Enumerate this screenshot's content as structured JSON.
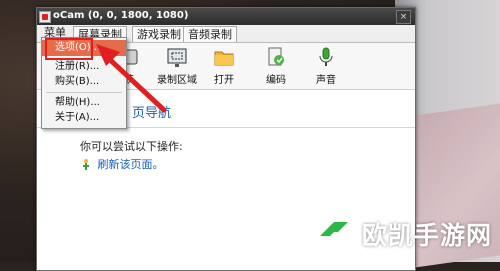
{
  "window": {
    "title": "oCam (0, 0, 1800, 1080)",
    "close": "×"
  },
  "menubar": {
    "menu": "菜单"
  },
  "tabs": [
    "屏幕录制",
    "游戏录制",
    "音频录制"
  ],
  "toolbar": {
    "items": [
      {
        "label": "获",
        "icon": "capture-icon"
      },
      {
        "label": "录制区域",
        "icon": "record-area-icon"
      },
      {
        "label": "打开",
        "icon": "folder-icon"
      },
      {
        "label": "编码",
        "icon": "codec-icon"
      },
      {
        "label": "声音",
        "icon": "sound-icon"
      }
    ]
  },
  "dropdown": {
    "items": [
      {
        "label": "选项(O)...",
        "selected": true
      },
      {
        "label": "注册(R)..."
      },
      {
        "label": "购买(B)..."
      },
      {
        "label": "帮助(H)..."
      },
      {
        "label": "关于(A)..."
      }
    ]
  },
  "content": {
    "heading": "页导航",
    "hint": "你可以尝试以下操作:",
    "refresh": "刷新该页面。"
  },
  "watermark": {
    "text": "欧凯手游网"
  },
  "colors": {
    "accent": "#e66b4a",
    "highlight": "#e02020",
    "link": "#1a5fb4",
    "brand": "#2db84a"
  }
}
